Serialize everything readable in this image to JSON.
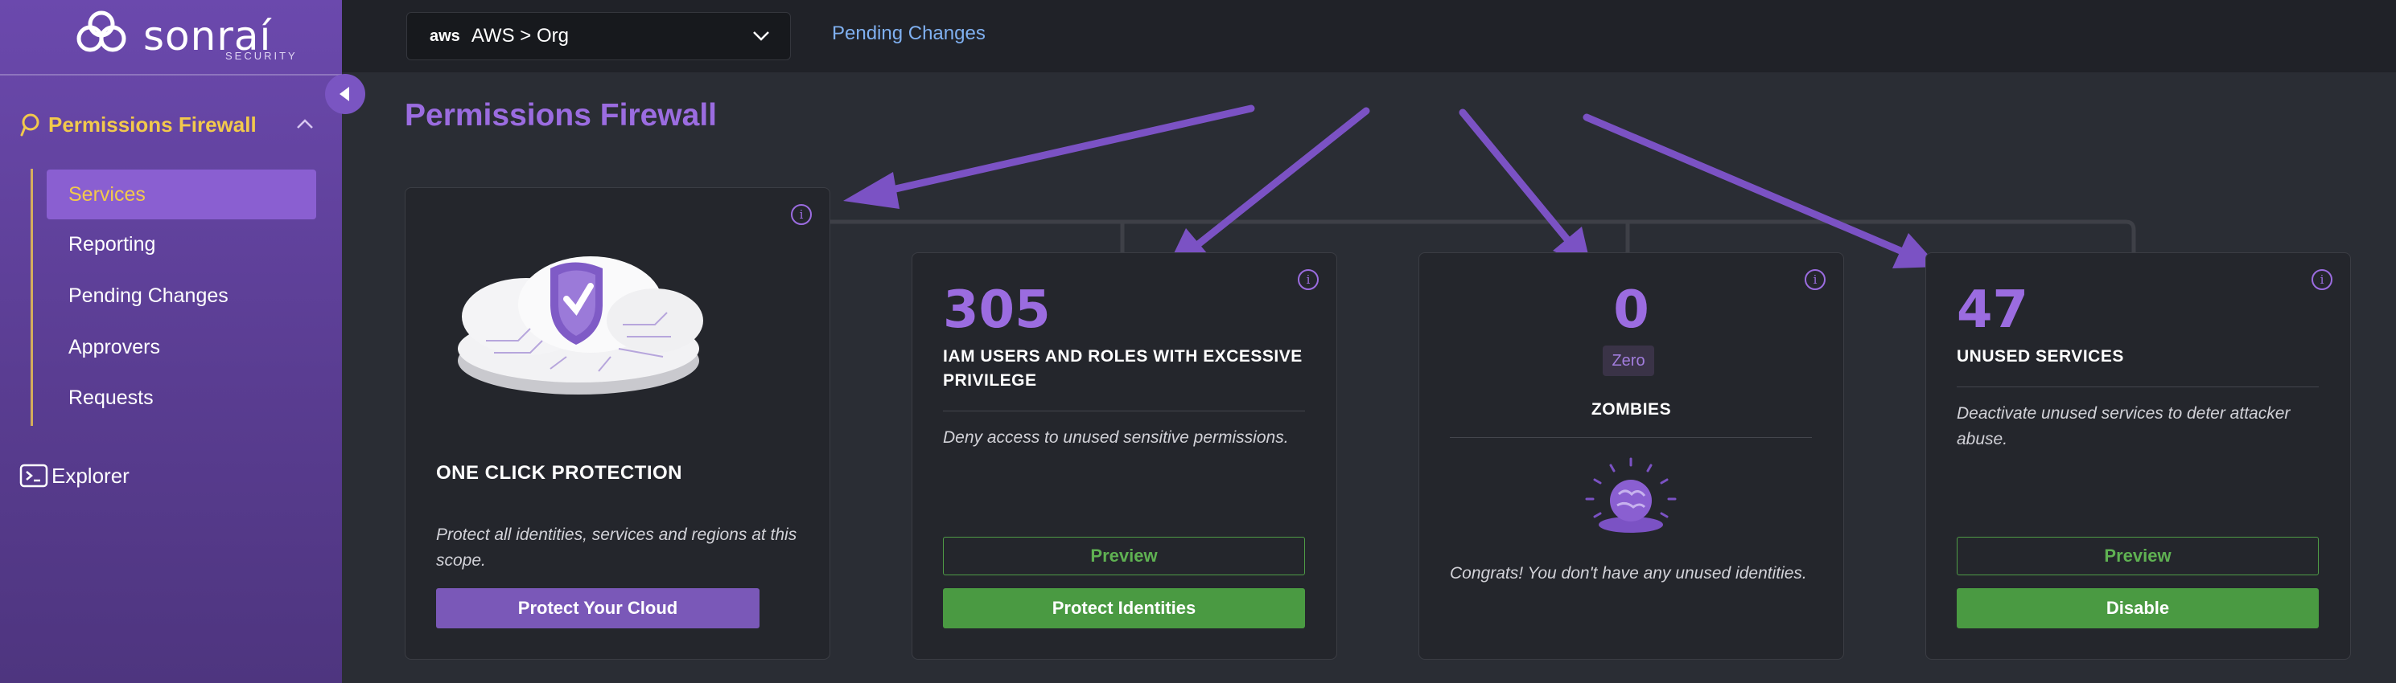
{
  "brand": {
    "name": "sonraí",
    "sub": "SECURITY"
  },
  "sidebar": {
    "section_label": "Permissions Firewall",
    "items": [
      {
        "label": "Services",
        "active": true
      },
      {
        "label": "Reporting"
      },
      {
        "label": "Pending Changes"
      },
      {
        "label": "Approvers"
      },
      {
        "label": "Requests"
      }
    ],
    "explorer_label": "Explorer"
  },
  "topbar": {
    "scope_provider": "aws",
    "scope_label": "AWS > Org",
    "pending_link": "Pending Changes"
  },
  "page": {
    "title": "Permissions Firewall"
  },
  "cards": {
    "protection": {
      "heading": "ONE CLICK PROTECTION",
      "desc": "Protect all identities, services and regions at this scope.",
      "button": "Protect Your Cloud"
    },
    "iam": {
      "count": "305",
      "heading": "IAM USERS AND ROLES WITH EXCESSIVE PRIVILEGE",
      "desc": "Deny access to unused sensitive permissions.",
      "preview": "Preview",
      "button": "Protect Identities"
    },
    "zombies": {
      "count": "0",
      "badge": "Zero",
      "heading": "ZOMBIES",
      "desc": "Congrats! You don't have any unused identities."
    },
    "unused": {
      "count": "47",
      "heading": "UNUSED SERVICES",
      "desc": "Deactivate unused services to deter attacker abuse.",
      "preview": "Preview",
      "button": "Disable"
    }
  },
  "colors": {
    "accent": "#9b6ce0",
    "yellow": "#f2c94c",
    "green": "#4a9a42",
    "arrow": "#7b52c4"
  }
}
